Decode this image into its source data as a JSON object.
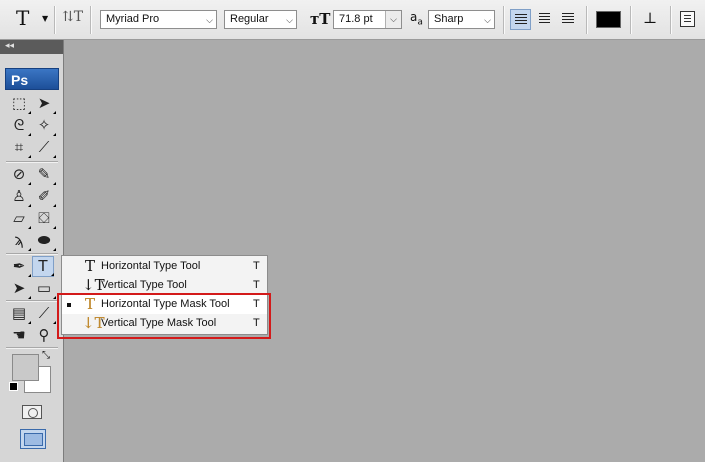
{
  "options_bar": {
    "tool_preset_icon": "T",
    "orientation_icon": "text-orientation-icon",
    "font_family": "Myriad Pro",
    "font_style": "Regular",
    "font_size": "71.8 pt",
    "antialias_label": "a",
    "antialias_sub": "a",
    "antialias": "Sharp",
    "alignment": [
      "left",
      "center",
      "right"
    ],
    "active_alignment": "left",
    "text_color": "#000000"
  },
  "toolbox": {
    "logo": "Ps",
    "foreground_color": "#c9c9c9",
    "background_color": "#ffffff"
  },
  "flyout": {
    "items": [
      {
        "icon": "T",
        "label": "Horizontal Type Tool",
        "shortcut": "T",
        "selected": false
      },
      {
        "icon": "T",
        "label": "Vertical Type Tool",
        "shortcut": "T",
        "selected": false
      },
      {
        "icon": "T",
        "label": "Horizontal Type Mask Tool",
        "shortcut": "T",
        "selected": true
      },
      {
        "icon": "T",
        "label": "Vertical Type Mask Tool",
        "shortcut": "T",
        "selected": false
      }
    ]
  },
  "canvas": {
    "background": "#ababab"
  },
  "highlight_color": "#d31a1a"
}
